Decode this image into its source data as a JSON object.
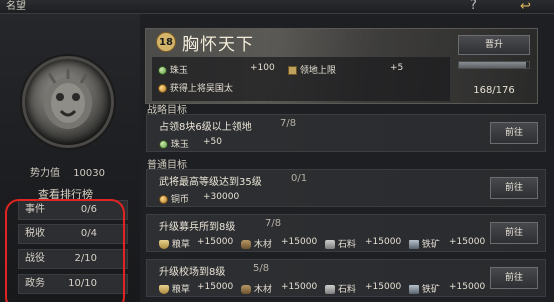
{
  "header": {
    "title": "名望",
    "help_icon": "?",
    "back_icon": "↩"
  },
  "left": {
    "power_label": "势力值",
    "power_value": "10030",
    "rank_link": "查看排行榜",
    "stats": [
      {
        "label": "事件",
        "value": "0/6"
      },
      {
        "label": "税收",
        "value": "0/4"
      },
      {
        "label": "战役",
        "value": "2/10"
      },
      {
        "label": "政务",
        "value": "10/10"
      }
    ]
  },
  "banner": {
    "level_badge": "18",
    "title": "胸怀天下",
    "rewards": [
      {
        "icon": "gem-icon",
        "name": "珠玉",
        "amount": "+100"
      },
      {
        "icon": "flag-icon",
        "name": "领地上限",
        "amount": "+5"
      }
    ],
    "extra_reward": {
      "icon": "coin-icon",
      "text": "获得上将吴国太"
    },
    "upgrade_label": "晋升",
    "progress_text": "168/176",
    "progress_fraction": 0.9545
  },
  "sections": {
    "battle_goal": "战略目标",
    "normal_goal": "普通目标"
  },
  "tasks": [
    {
      "name": "占领8块6级以上领地",
      "progress": "7/8",
      "rewards": [
        {
          "icon": "gem-icon",
          "name": "珠玉",
          "amount": "+50"
        }
      ],
      "button": "前往"
    },
    {
      "name": "武将最高等级达到35级",
      "progress": "0/1",
      "rewards": [
        {
          "icon": "coin-icon",
          "name": "铜币",
          "amount": "+30000"
        }
      ],
      "button": "前往"
    },
    {
      "name": "升级募兵所到8级",
      "progress": "7/8",
      "rewards": [
        {
          "icon": "grain-icon",
          "name": "粮草",
          "amount": "+15000"
        },
        {
          "icon": "wood-icon",
          "name": "木材",
          "amount": "+15000"
        },
        {
          "icon": "stone-icon",
          "name": "石料",
          "amount": "+15000"
        },
        {
          "icon": "iron-icon",
          "name": "铁矿",
          "amount": "+15000"
        }
      ],
      "button": "前往"
    },
    {
      "name": "升级校场到8级",
      "progress": "5/8",
      "rewards": [
        {
          "icon": "grain-icon",
          "name": "粮草",
          "amount": "+15000"
        },
        {
          "icon": "wood-icon",
          "name": "木材",
          "amount": "+15000"
        },
        {
          "icon": "stone-icon",
          "name": "石料",
          "amount": "+15000"
        },
        {
          "icon": "iron-icon",
          "name": "铁矿",
          "amount": "+15000"
        }
      ],
      "button": "前往"
    }
  ],
  "colors": {
    "accent": "#d4b46a",
    "annotation": "#e02424",
    "panel": "#2d2f32"
  }
}
